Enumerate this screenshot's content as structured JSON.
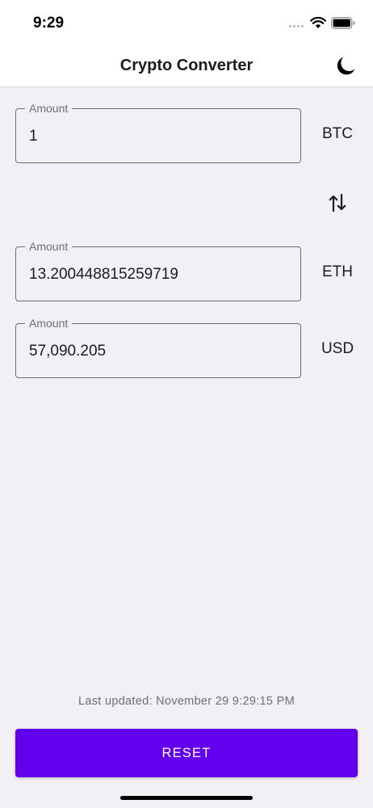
{
  "status_bar": {
    "time": "9:29",
    "wifi_icon": "wifi-icon",
    "battery_icon": "battery-icon"
  },
  "app_bar": {
    "title": "Crypto Converter",
    "theme_toggle_icon": "moon-icon"
  },
  "converter": {
    "fields": [
      {
        "label": "Amount",
        "value": "1",
        "currency": "BTC"
      },
      {
        "label": "Amount",
        "value": "13.200448815259719",
        "currency": "ETH"
      },
      {
        "label": "Amount",
        "value": "57,090.205",
        "currency": "USD"
      }
    ],
    "swap_icon": "swap-vertical-icon"
  },
  "footer": {
    "last_updated": "Last updated: November 29 9:29:15 PM",
    "reset_label": "RESET"
  },
  "colors": {
    "accent": "#6200ee",
    "background": "#f2f0f4",
    "surface": "#ffffff",
    "outline": "#6f6c73"
  }
}
